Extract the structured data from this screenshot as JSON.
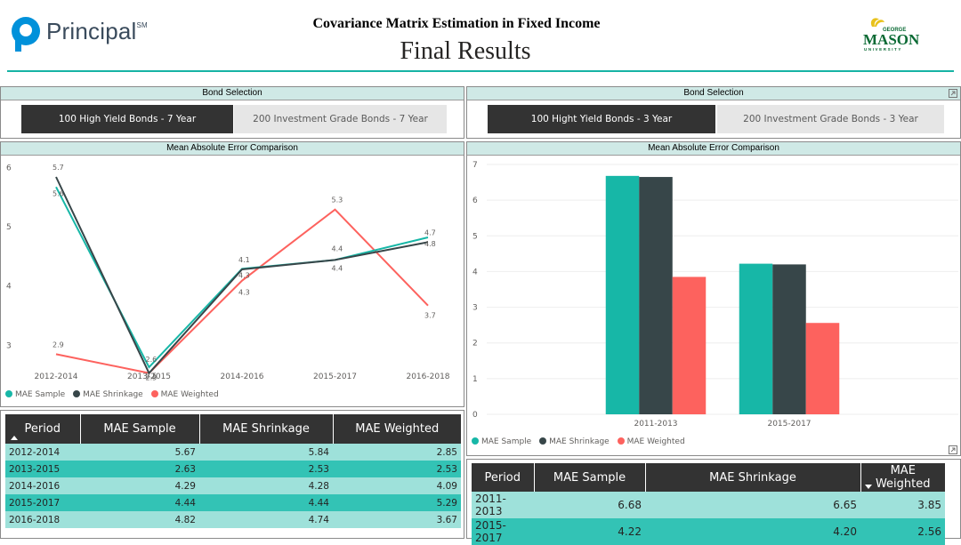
{
  "header": {
    "logo_text": "Principal",
    "logo_sup": "SM",
    "title": "Covariance Matrix Estimation in Fixed Income",
    "subtitle": "Final Results",
    "right_logo": {
      "line1": "GEORGE",
      "line2": "MASON",
      "line3": "UNIVERSITY"
    }
  },
  "colors": {
    "sample": "#17b7a7",
    "shrinkage": "#374649",
    "weighted": "#fd625e",
    "accent_rule": "#16b3a4",
    "selected": "#333333"
  },
  "left": {
    "slicer": {
      "title": "Bond Selection",
      "options": [
        {
          "label": "100 High Yield Bonds - 7 Year",
          "selected": true
        },
        {
          "label": "200 Investment Grade Bonds - 7 Year",
          "selected": false
        }
      ]
    },
    "chart_title": "Mean Absolute Error Comparison",
    "legend": [
      "MAE Sample",
      "MAE Shrinkage",
      "MAE Weighted"
    ],
    "table": {
      "headers": [
        "Period",
        "MAE Sample",
        "MAE Shrinkage",
        "MAE Weighted"
      ],
      "rows": [
        [
          "2012-2014",
          "5.67",
          "5.84",
          "2.85"
        ],
        [
          "2013-2015",
          "2.63",
          "2.53",
          "2.53"
        ],
        [
          "2014-2016",
          "4.29",
          "4.28",
          "4.09"
        ],
        [
          "2015-2017",
          "4.44",
          "4.44",
          "5.29"
        ],
        [
          "2016-2018",
          "4.82",
          "4.74",
          "3.67"
        ]
      ]
    }
  },
  "right": {
    "slicer": {
      "title": "Bond Selection",
      "options": [
        {
          "label": "100 Hight Yield Bonds - 3 Year",
          "selected": true
        },
        {
          "label": "200 Investment Grade Bonds - 3 Year",
          "selected": false
        }
      ]
    },
    "chart_title": "Mean Absolute Error Comparison",
    "legend": [
      "MAE Sample",
      "MAE Shrinkage",
      "MAE Weighted"
    ],
    "table": {
      "headers": [
        "Period",
        "MAE Sample",
        "MAE Shrinkage",
        "MAE Weighted"
      ],
      "rows": [
        [
          "2011-2013",
          "6.68",
          "6.65",
          "3.85"
        ],
        [
          "2015-2017",
          "4.22",
          "4.20",
          "2.56"
        ]
      ]
    }
  },
  "chart_data": [
    {
      "type": "line",
      "title": "Mean Absolute Error Comparison",
      "categories": [
        "2012-2014",
        "2013-2015",
        "2014-2016",
        "2015-2017",
        "2016-2018"
      ],
      "yticks": [
        "3",
        "4",
        "5",
        "6"
      ],
      "ylim": [
        2.6,
        6.05
      ],
      "series": [
        {
          "name": "MAE Sample",
          "values": [
            5.67,
            2.63,
            4.29,
            4.44,
            4.82
          ],
          "labels": [
            "5.6",
            "2.6",
            "4.3",
            "4.4",
            "4.8"
          ]
        },
        {
          "name": "MAE Shrinkage",
          "values": [
            5.84,
            2.53,
            4.28,
            4.44,
            4.74
          ],
          "labels": [
            "5.7",
            "2.5",
            "4.1",
            "4.4",
            "4.7"
          ]
        },
        {
          "name": "MAE Weighted",
          "values": [
            2.85,
            2.53,
            4.09,
            5.29,
            3.67
          ],
          "labels": [
            "2.9",
            "2.5",
            "4.3",
            "5.3",
            "3.7"
          ]
        }
      ],
      "legend_position": "bottom-left",
      "grid": false
    },
    {
      "type": "bar",
      "title": "Mean Absolute Error Comparison",
      "categories": [
        "2011-2013",
        "2015-2017"
      ],
      "yticks": [
        "0",
        "1",
        "2",
        "3",
        "4",
        "5",
        "6",
        "7"
      ],
      "ylim": [
        0,
        7
      ],
      "series": [
        {
          "name": "MAE Sample",
          "values": [
            6.68,
            4.22
          ]
        },
        {
          "name": "MAE Shrinkage",
          "values": [
            6.65,
            4.2
          ]
        },
        {
          "name": "MAE Weighted",
          "values": [
            3.85,
            2.56
          ]
        }
      ],
      "legend_position": "bottom-left",
      "grid": true
    }
  ]
}
